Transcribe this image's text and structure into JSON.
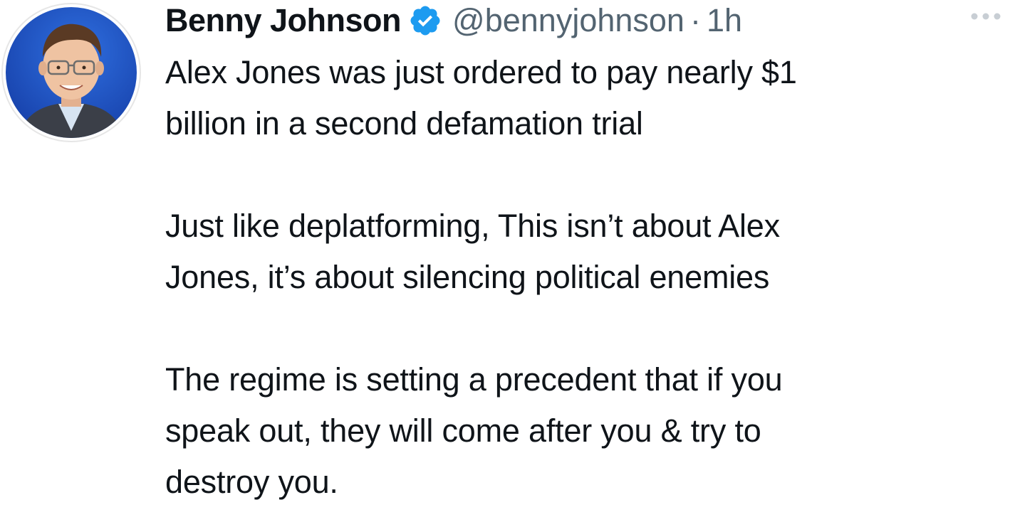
{
  "author": {
    "name": "Benny Johnson",
    "handle": "@bennyjohnson",
    "separator": "·",
    "time": "1h",
    "verified": true,
    "avatar_icon": "profile-photo"
  },
  "tweet": {
    "paragraphs": [
      {
        "lines": [
          "Alex Jones was just ordered to pay nearly $1",
          "billion in a second defamation trial"
        ]
      },
      {
        "lines": [
          "Just like deplatforming, This isn’t about Alex",
          "Jones, it’s about silencing political enemies"
        ]
      },
      {
        "lines": [
          "The regime is setting a precedent that if you",
          "speak out, they will come after you & try to",
          "destroy you."
        ]
      }
    ]
  },
  "icons": {
    "verified": "verified-badge-icon",
    "more": "more-options-icon"
  },
  "colors": {
    "text": "#0f1419",
    "secondary": "#536471",
    "verified_blue": "#1d9bf0",
    "avatar_background": "#1f56c9"
  }
}
